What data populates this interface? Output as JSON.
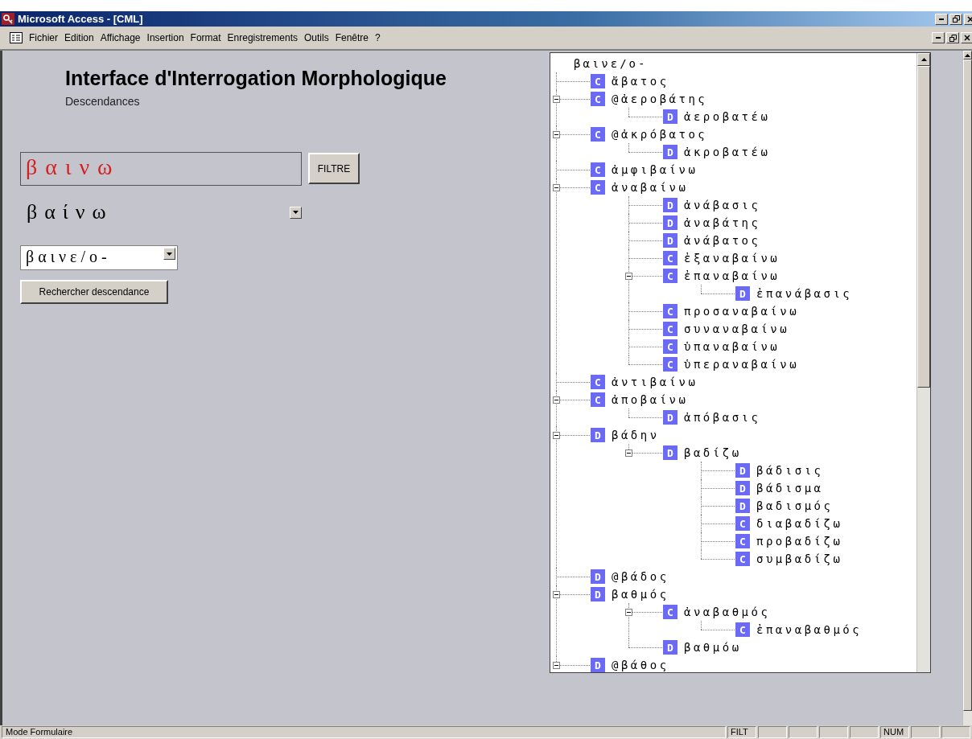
{
  "window": {
    "title": "Microsoft Access - [CML]"
  },
  "menu": [
    "Fichier",
    "Edition",
    "Affichage",
    "Insertion",
    "Format",
    "Enregistrements",
    "Outils",
    "Fenêtre",
    "?"
  ],
  "form": {
    "title": "Interface d'Interrogation Morphologique",
    "subtitle": "Descendances",
    "filter_value": "βαινω",
    "filter_button": "FILTRE",
    "lemma": "βαίνω",
    "root_value": "βαινε/ο-",
    "search_button": "Rechercher descendance"
  },
  "tree": {
    "root": "βαινε/ο-",
    "items": [
      {
        "badge": "C",
        "label": "ἄβατος"
      },
      {
        "badge": "C",
        "label": "@ἀεροβάτης",
        "expanded": true,
        "children": [
          {
            "badge": "D",
            "label": "ἀεροβατέω"
          }
        ]
      },
      {
        "badge": "C",
        "label": "@ἀκρόβατος",
        "expanded": true,
        "children": [
          {
            "badge": "D",
            "label": "ἀκροβατέω"
          }
        ]
      },
      {
        "badge": "C",
        "label": "ἀμφιβαίνω"
      },
      {
        "badge": "C",
        "label": "ἀναβαίνω",
        "expanded": true,
        "children": [
          {
            "badge": "D",
            "label": "ἀνάβασις"
          },
          {
            "badge": "D",
            "label": "ἀναβάτης"
          },
          {
            "badge": "D",
            "label": "ἀνάβατος"
          },
          {
            "badge": "C",
            "label": "ἐξαναβαίνω"
          },
          {
            "badge": "C",
            "label": "ἐπαναβαίνω",
            "expanded": true,
            "children": [
              {
                "badge": "D",
                "label": "ἐπανάβασις"
              }
            ]
          },
          {
            "badge": "C",
            "label": "προσαναβαίνω"
          },
          {
            "badge": "C",
            "label": "συναναβαίνω"
          },
          {
            "badge": "C",
            "label": "ὑπαναβαίνω"
          },
          {
            "badge": "C",
            "label": "ὑπεραναβαίνω"
          }
        ]
      },
      {
        "badge": "C",
        "label": "ἀντιβαίνω"
      },
      {
        "badge": "C",
        "label": "ἀποβαίνω",
        "expanded": true,
        "children": [
          {
            "badge": "D",
            "label": "ἀπόβασις"
          }
        ]
      },
      {
        "badge": "D",
        "label": "βάδην",
        "expanded": true,
        "children": [
          {
            "badge": "D",
            "label": "βαδίζω",
            "expanded": true,
            "children": [
              {
                "badge": "D",
                "label": "βάδισις"
              },
              {
                "badge": "D",
                "label": "βάδισμα"
              },
              {
                "badge": "D",
                "label": "βαδισμός"
              },
              {
                "badge": "C",
                "label": "διαβαδίζω"
              },
              {
                "badge": "C",
                "label": "προβαδίζω"
              },
              {
                "badge": "C",
                "label": "συμβαδίζω"
              }
            ]
          }
        ]
      },
      {
        "badge": "D",
        "label": "@βάδος"
      },
      {
        "badge": "D",
        "label": "βαθμός",
        "expanded": true,
        "children": [
          {
            "badge": "C",
            "label": "ἀναβαθμός",
            "expanded": true,
            "children": [
              {
                "badge": "C",
                "label": "ἐπαναβαθμός"
              }
            ]
          },
          {
            "badge": "D",
            "label": "βαθμόω"
          }
        ]
      },
      {
        "badge": "D",
        "label": "@βάθος",
        "expanded": true
      }
    ]
  },
  "status_bar": {
    "mode": "Mode Formulaire",
    "indicators": [
      "FILT",
      "NUM"
    ]
  }
}
